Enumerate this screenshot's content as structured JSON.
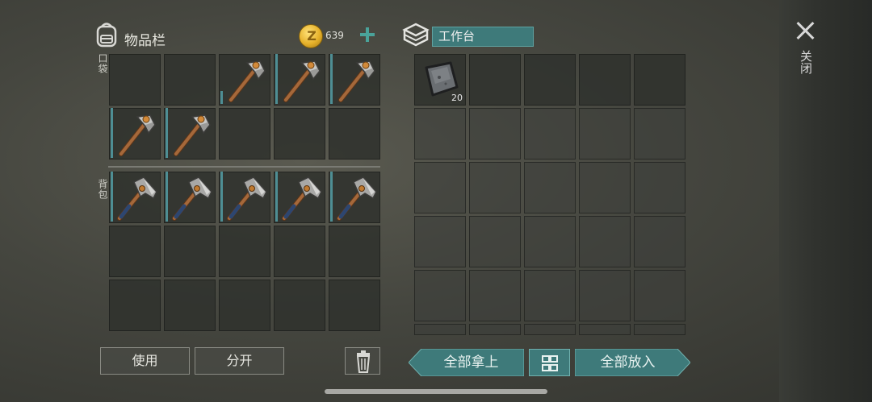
{
  "inventory": {
    "title": "物品栏",
    "icon": "backpack-icon",
    "currency": {
      "icon": "coin-icon",
      "symbol": "Z",
      "amount": "639",
      "add_icon": "plus-icon"
    },
    "pocket_label": "口袋",
    "backpack_label": "背包",
    "pocket_slots": [
      {
        "item": null
      },
      {
        "item": null
      },
      {
        "item": "hammer",
        "durability": 0.25
      },
      {
        "item": "hammer",
        "durability": 1.0
      },
      {
        "item": "hammer",
        "durability": 1.0
      },
      {
        "item": "hammer",
        "durability": 1.0
      },
      {
        "item": "hammer",
        "durability": 1.0
      },
      {
        "item": null
      },
      {
        "item": null
      },
      {
        "item": null
      }
    ],
    "backpack_slots": [
      {
        "item": "hatchet",
        "durability": 1.0
      },
      {
        "item": "hatchet",
        "durability": 1.0
      },
      {
        "item": "hatchet",
        "durability": 1.0
      },
      {
        "item": "hatchet",
        "durability": 1.0
      },
      {
        "item": "hatchet",
        "durability": 1.0
      },
      {
        "item": null
      },
      {
        "item": null
      },
      {
        "item": null
      },
      {
        "item": null
      },
      {
        "item": null
      },
      {
        "item": null
      },
      {
        "item": null
      },
      {
        "item": null
      },
      {
        "item": null
      },
      {
        "item": null
      }
    ],
    "buttons": {
      "use": "使用",
      "split": "分开",
      "trash_icon": "trash-icon"
    }
  },
  "workbench": {
    "icon": "workbench-icon",
    "title": "工作台",
    "slots": [
      {
        "item": "iron-plate",
        "qty": "20"
      }
    ],
    "buttons": {
      "take_all": "全部拿上",
      "sort_icon": "grid-sort-icon",
      "put_all": "全部放入"
    }
  },
  "close": {
    "icon": "close-icon",
    "label": "关闭"
  },
  "colors": {
    "accent": "#3e7a7a",
    "durability": "#4e8e94",
    "coin": "#e6b12a"
  }
}
